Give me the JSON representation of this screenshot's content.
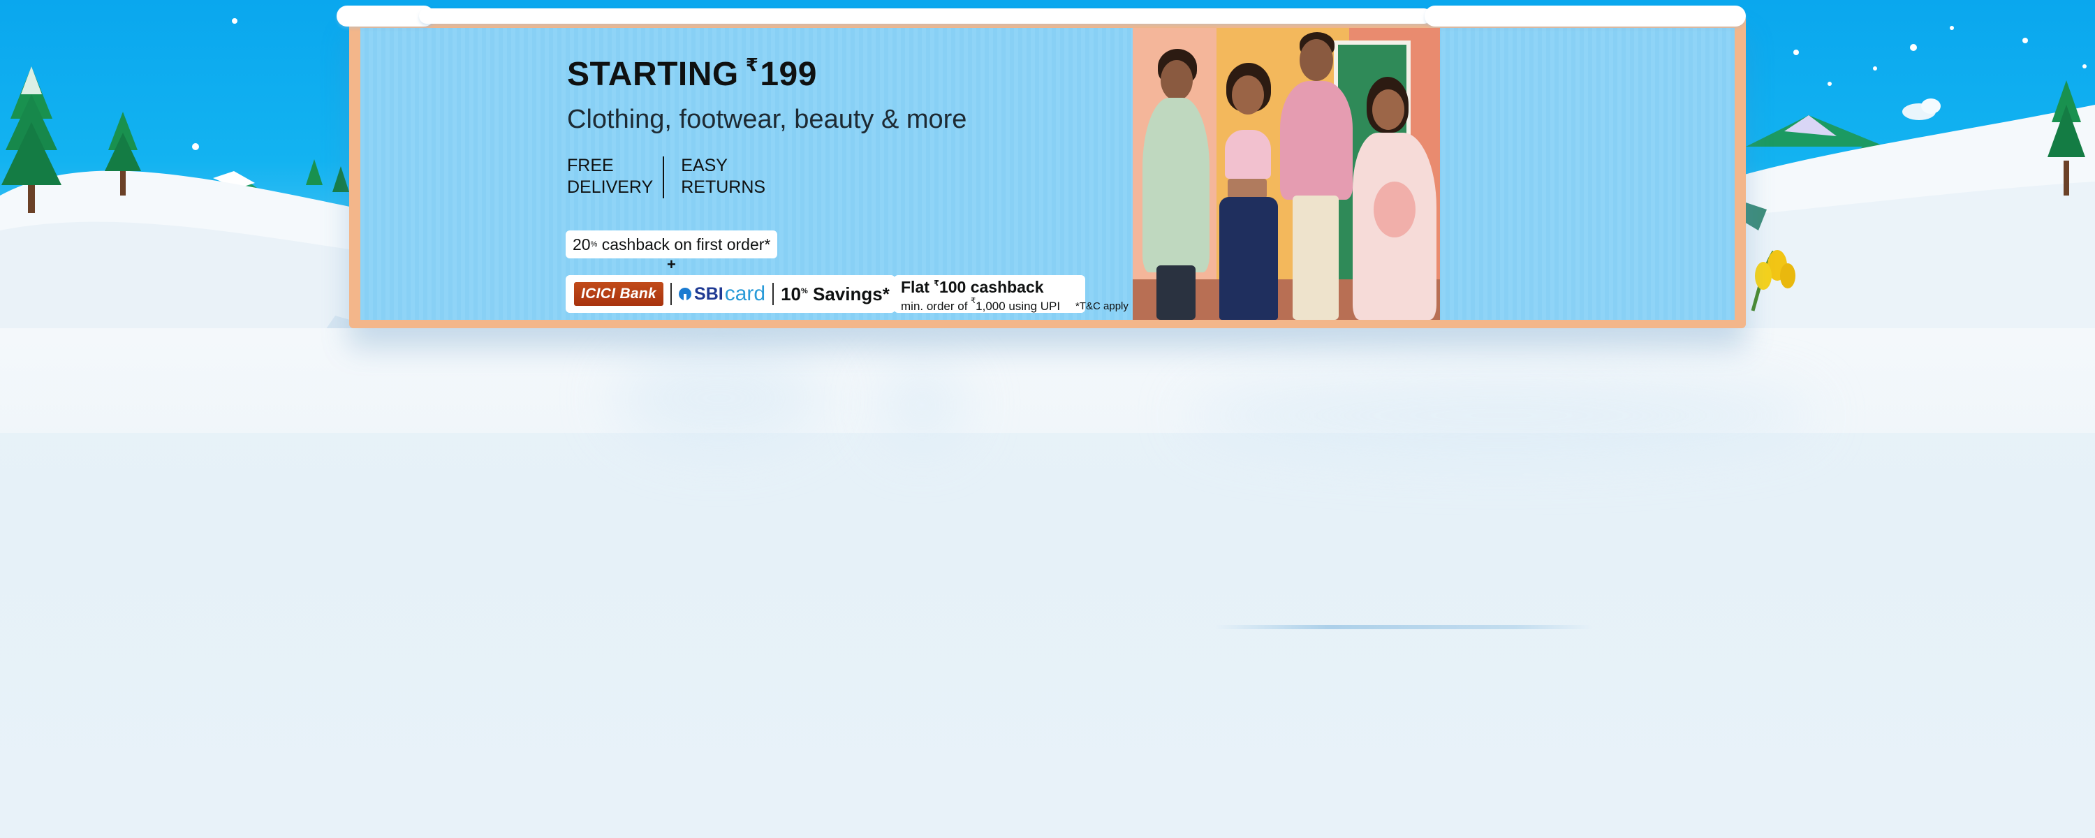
{
  "banner": {
    "headline": {
      "prefix": "STARTING",
      "currency": "₹",
      "price": "199"
    },
    "subline": "Clothing, footwear, beauty & more",
    "features": [
      {
        "line1": "FREE",
        "line2": "DELIVERY"
      },
      {
        "line1": "EASY",
        "line2": "RETURNS"
      }
    ],
    "cashback": {
      "pct": "20",
      "pct_sup": "%",
      "text": " cashback on first order*"
    },
    "plus": "+",
    "bank_offer": {
      "icici": "ICICI Bank",
      "sbi": "SBI",
      "card": "card",
      "savings_pct": "10",
      "savings_sup": "%",
      "savings_text": " Savings*"
    },
    "upi_offer": {
      "title_prefix": "Flat ",
      "title_currency": "₹",
      "title_rest": "100 cashback",
      "sub_prefix": "min. order of ",
      "sub_currency": "₹",
      "sub_rest": "1,000 using UPI"
    },
    "tnc": "*T&C apply"
  },
  "colors": {
    "sky": "#0aa7ee",
    "banner_bg": "#8fd4f7",
    "frame": "#f3b68a",
    "icici_brand": "#b23c12",
    "sbi_blue": "#1f3a93"
  },
  "icons": {
    "icici_logo": "icici-bank-logo",
    "sbi_logo": "sbi-card-logo"
  }
}
